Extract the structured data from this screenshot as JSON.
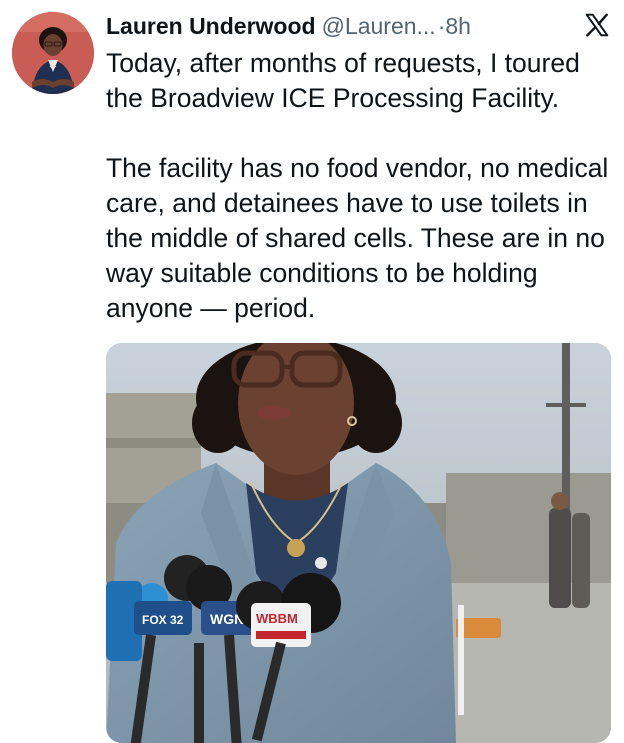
{
  "tweet": {
    "author_name": "Lauren Underwood",
    "handle": "@Lauren...",
    "separator": "·",
    "time": "8h",
    "paragraphs": [
      "Today, after months of requests, I toured the Broadview ICE Processing Facility.",
      "The facility has no food vendor, no medical care, and detainees have to use toilets in the middle of shared cells. These are in no way suitable conditions to be holding anyone — period."
    ]
  },
  "media": {
    "microphone_flags": [
      "FOX 32",
      "WGN",
      "WBBM"
    ]
  },
  "icons": {
    "platform": "x-logo-icon",
    "avatar": "avatar-photo"
  },
  "colors": {
    "text": "#0f1419",
    "secondary_text": "#536471",
    "avatar_bg": "#c95c55"
  }
}
